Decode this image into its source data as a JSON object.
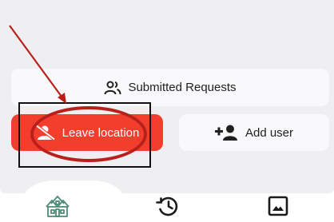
{
  "actions": {
    "submitted_requests_label": "Submitted Requests",
    "leave_location_label": "Leave location",
    "add_user_label": "Add user"
  },
  "bottom_nav": {
    "items": [
      {
        "icon": "houses-icon",
        "active": true
      },
      {
        "icon": "history-icon",
        "active": false
      },
      {
        "icon": "image-icon",
        "active": false
      }
    ]
  },
  "colors": {
    "panel_bg": "#efeff2",
    "button_bg": "#f9f9fb",
    "leave_button_bg": "#f33d2d",
    "active_nav_icon": "#4d8a78",
    "annotation_red": "#b8211b",
    "annotation_box": "#111111"
  },
  "annotation": {
    "shapes": [
      "arrow",
      "ellipse",
      "box"
    ]
  }
}
